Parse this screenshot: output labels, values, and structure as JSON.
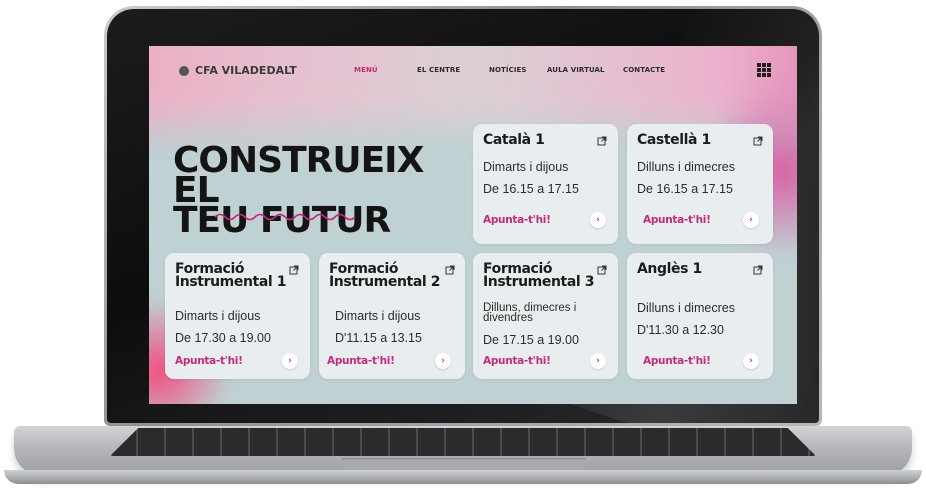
{
  "brand": {
    "name": "CFA VILADEDALT"
  },
  "nav": {
    "items": [
      {
        "label": "MENÚ",
        "active": true
      },
      {
        "label": "EL CENTRE"
      },
      {
        "label": "NOTÍCIES"
      },
      {
        "label": "AULA VIRTUAL"
      },
      {
        "label": "CONTACTE"
      }
    ],
    "apps_icon": "grid-apps-icon"
  },
  "hero": {
    "line1": "CONSTRUEIX EL",
    "line2": "TEU FUTUR"
  },
  "cta_arrow": "›",
  "cards": [
    {
      "title": "Català 1",
      "days": "Dimarts i dijous",
      "time": "De 16.15 a 17.15",
      "cta": "Apunta-t'hi!"
    },
    {
      "title": "Castellà 1",
      "days": "Dilluns i dimecres",
      "time": "De 16.15 a 17.15",
      "cta": "Apunta-t'hi!"
    },
    {
      "title": "Formació Instrumental 1",
      "days": "Dimarts i dijous",
      "time": "De 17.30 a 19.00",
      "cta": "Apunta-t'hi!"
    },
    {
      "title": "Formació Instrumental 2",
      "days": "Dimarts i dijous",
      "time": "D'11.15 a 13.15",
      "cta": "Apunta-t'hi!"
    },
    {
      "title": "Formació Instrumental 3",
      "days": "Dilluns, dimecres i divendres",
      "time": "De 17.15 a 19.00",
      "cta": "Apunta-t'hi!"
    },
    {
      "title": "Anglès 1",
      "days": "Dilluns i dimecres",
      "time": "D'11.30 a 12.30",
      "cta": "Apunta-t'hi!"
    }
  ],
  "colors": {
    "accent": "#c8287a",
    "screen_bg": "#bfd1d3",
    "card_bg": "#e8eef0"
  }
}
